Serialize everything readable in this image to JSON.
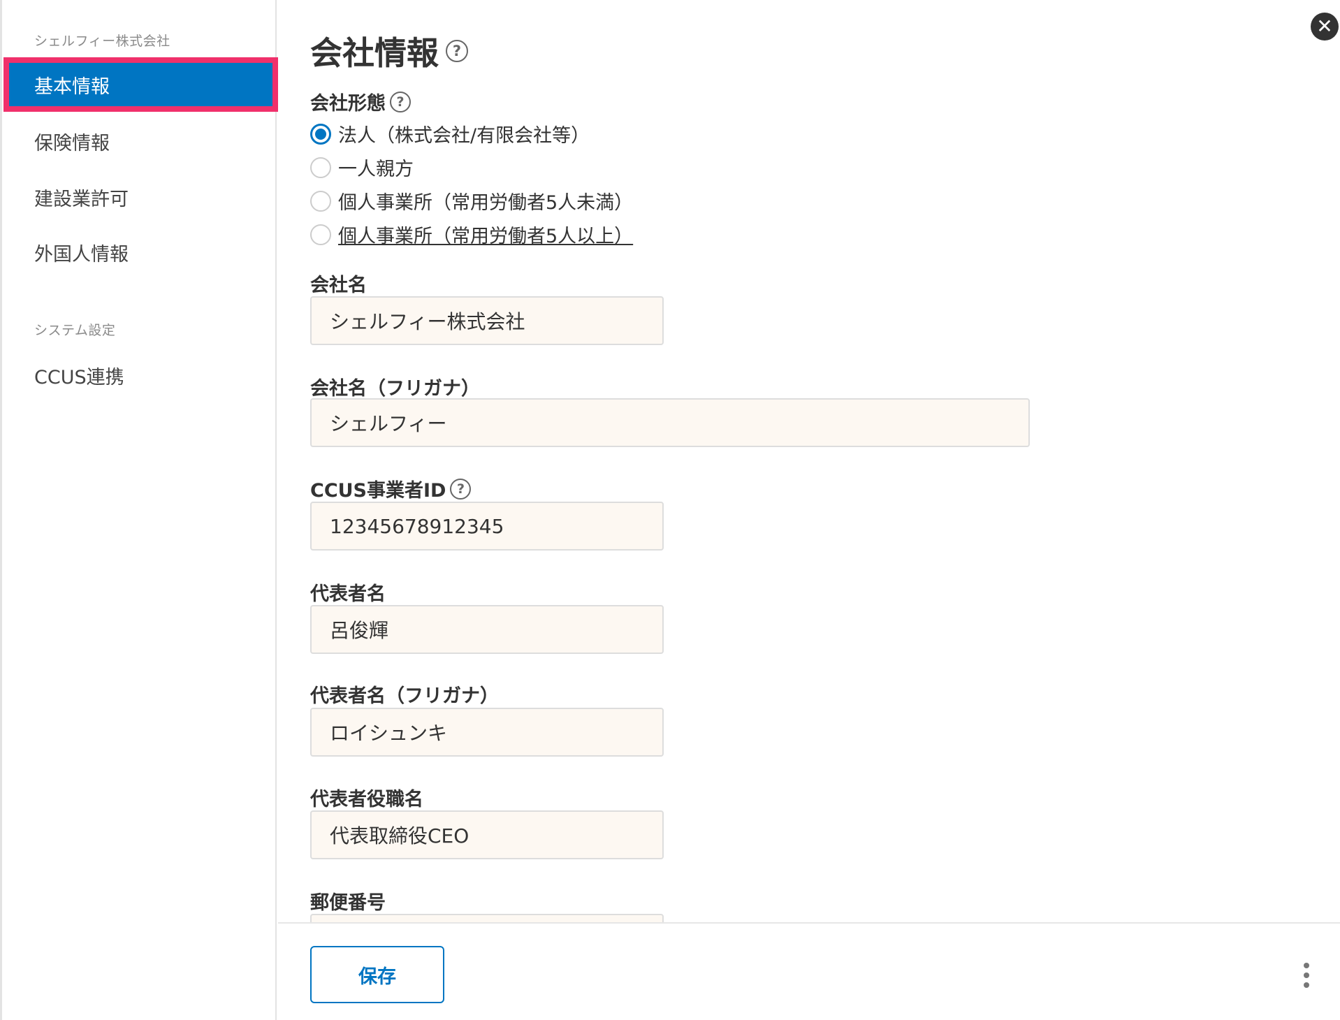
{
  "sidebar": {
    "section1": "シェルフィー株式会社",
    "items": [
      "基本情報",
      "保険情報",
      "建設業許可",
      "外国人情報"
    ],
    "section2": "システム設定",
    "system_items": [
      "CCUS連携"
    ]
  },
  "main": {
    "title": "会社情報",
    "help_glyph": "?",
    "company_type": {
      "label": "会社形態",
      "options": [
        "法人（株式会社/有限会社等）",
        "一人親方",
        "個人事業所（常用労働者5人未満）",
        "個人事業所（常用労働者5人以上）"
      ],
      "selected_index": 0
    },
    "fields": {
      "company_name": {
        "label": "会社名",
        "value": "シェルフィー株式会社"
      },
      "company_name_kana": {
        "label": "会社名（フリガナ）",
        "value": "シェルフィー"
      },
      "ccus_id": {
        "label": "CCUS事業者ID",
        "value": "12345678912345"
      },
      "rep_name": {
        "label": "代表者名",
        "value": "呂俊輝"
      },
      "rep_name_kana": {
        "label": "代表者名（フリガナ）",
        "value": "ロイシュンキ"
      },
      "rep_title": {
        "label": "代表者役職名",
        "value": "代表取締役CEO"
      },
      "postal_code": {
        "label": "郵便番号",
        "value": ""
      }
    }
  },
  "footer": {
    "save_label": "保存"
  },
  "close_glyph": "✕"
}
